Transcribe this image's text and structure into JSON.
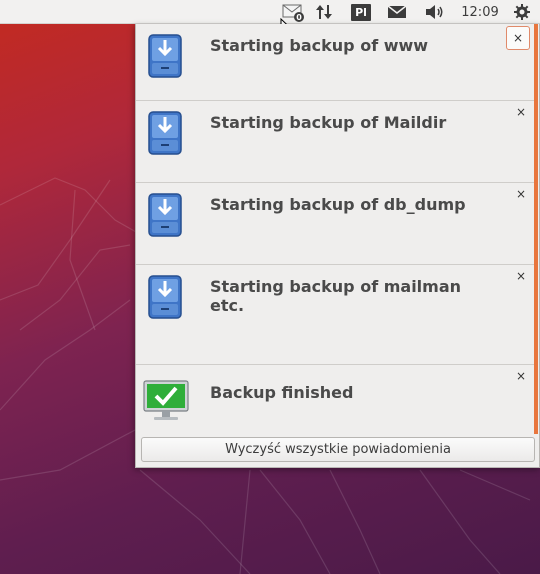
{
  "panel": {
    "clock": "12:09",
    "keyboard_layout": "Pl",
    "mail_badge_count": "0",
    "icons": [
      "mail-notification-icon",
      "network-icon",
      "keyboard-layout-icon",
      "messaging-icon",
      "volume-icon",
      "session-gear-icon"
    ]
  },
  "notifications": [
    {
      "title": "Starting backup of www",
      "icon": "backup-drawer-icon"
    },
    {
      "title": "Starting backup of Maildir",
      "icon": "backup-drawer-icon"
    },
    {
      "title": "Starting backup of db_dump",
      "icon": "backup-drawer-icon"
    },
    {
      "title": "Starting backup of mailman etc.",
      "icon": "backup-drawer-icon"
    },
    {
      "title": "Backup finished",
      "icon": "monitor-check-icon"
    }
  ],
  "close_glyph": "×",
  "clear_all_label": "Wyczyść wszystkie powiadomienia",
  "colors": {
    "accent": "#e8763e",
    "panel_bg": "#efeeed",
    "title_text": "#4a4a4a",
    "wallpaper_top": "#c42a1f",
    "wallpaper_bottom": "#4a1a48"
  }
}
